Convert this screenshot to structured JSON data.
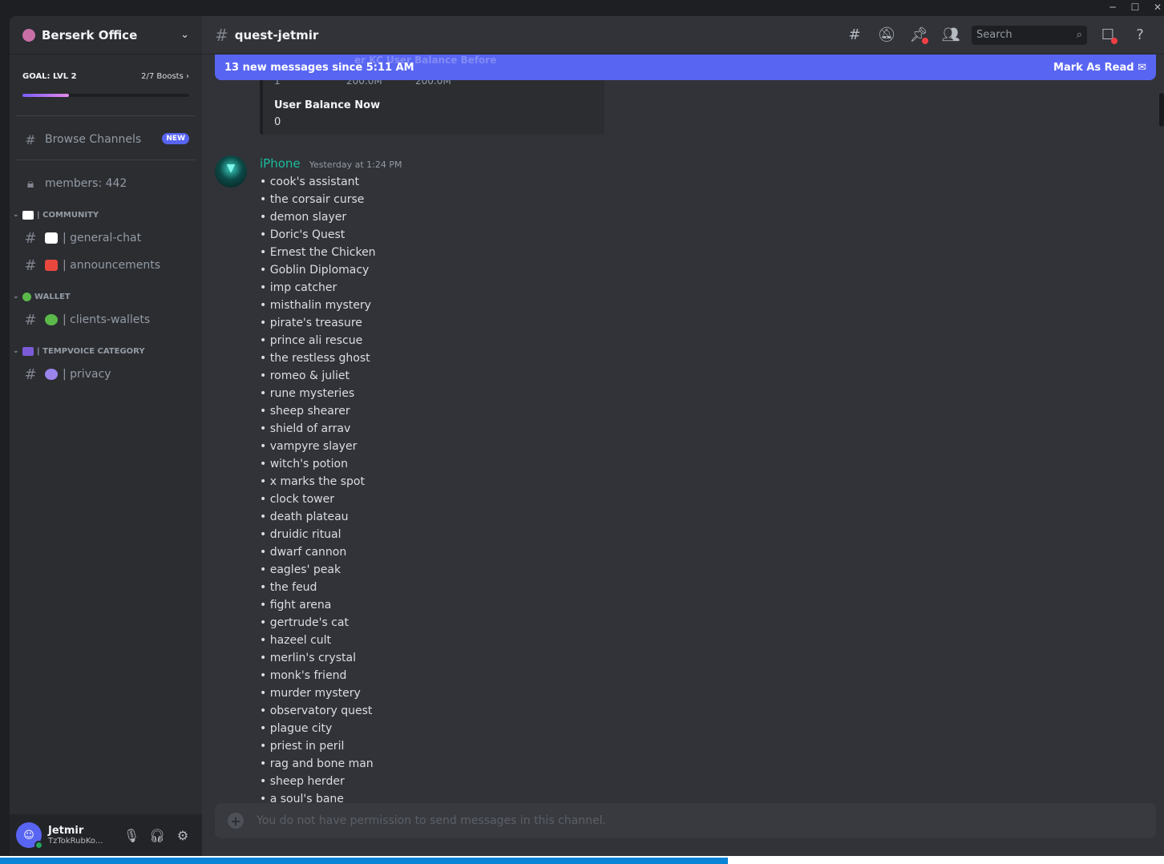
{
  "window": {
    "minimize": "─",
    "maximize": "☐",
    "close": "✕"
  },
  "server": {
    "name": "Berserk Office"
  },
  "goal": {
    "label": "GOAL: LVL 2",
    "boosts": "2/7 Boosts",
    "progress": 0.28
  },
  "sidebar": {
    "browse": {
      "label": "Browse Channels",
      "badge": "NEW"
    },
    "members": {
      "label": "members: 442"
    },
    "categories": [
      {
        "name": "| COMMUNITY",
        "emoji_color": "#ffffff",
        "channels": [
          {
            "label": "| general-chat",
            "emoji_color": "#ffffff"
          },
          {
            "label": "| announcements",
            "emoji_color": "#e8473e"
          }
        ]
      },
      {
        "name": "WALLET",
        "emoji_color": "#5ab94a",
        "channels": [
          {
            "label": "| clients-wallets",
            "emoji_color": "#5ab94a"
          }
        ]
      },
      {
        "name": "| TEMPVOICE CATEGORY",
        "emoji_color": "#7b5cd6",
        "channels": [
          {
            "label": "| privacy",
            "emoji_color": "#9b84ec"
          }
        ]
      }
    ]
  },
  "user": {
    "name": "Jetmir",
    "sub": "TzTokRubKo...",
    "avatar_glyph": "☺"
  },
  "channel": {
    "name": "quest-jetmir"
  },
  "search": {
    "placeholder": "Search"
  },
  "newbar": {
    "text": "13 new messages since 5:11 AM",
    "action": "Mark As Read",
    "behind_text": "er KC   User Balance Before"
  },
  "embed": {
    "ghost_left": "1",
    "ghost_mid": "200.0M",
    "ghost_right": "200.0M",
    "label": "User Balance Now",
    "value": "0"
  },
  "message": {
    "author": "iPhone",
    "timestamp": "Yesterday at 1:24 PM",
    "author_color": "#1abc9c",
    "lines": [
      "cook's assistant",
      "the corsair curse",
      "demon slayer",
      "Doric's Quest",
      "Ernest the Chicken",
      "Goblin Diplomacy",
      "imp catcher",
      "misthalin mystery",
      "pirate's treasure",
      "prince ali rescue",
      "the restless ghost",
      "romeo & juliet",
      "rune mysteries",
      "sheep shearer",
      "shield of arrav",
      "vampyre slayer",
      "witch's potion",
      "x marks the spot",
      "clock tower",
      "death plateau",
      "druidic ritual",
      "dwarf cannon",
      "eagles' peak",
      "the feud",
      "fight arena",
      "gertrude's cat",
      "hazeel cult",
      "merlin's crystal",
      "monk's friend",
      "murder mystery",
      "observatory quest",
      "plague city",
      "priest in peril",
      "rag and bone man",
      "sheep herder",
      "a soul's bane"
    ]
  },
  "composer": {
    "placeholder": "You do not have permission to send messages in this channel."
  },
  "colors": {
    "accent": "#5865f2",
    "online": "#23a55a",
    "alert": "#f23f43"
  }
}
